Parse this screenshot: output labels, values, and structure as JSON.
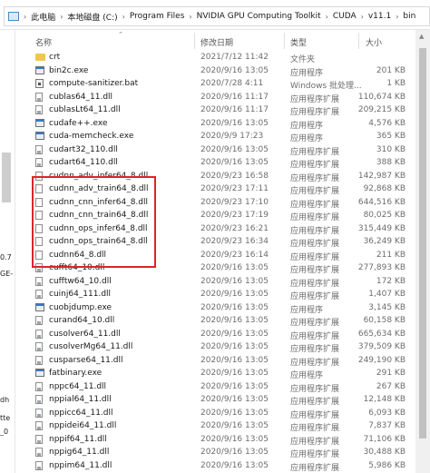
{
  "breadcrumb": {
    "items": [
      "此电脑",
      "本地磁盘 (C:)",
      "Program Files",
      "NVIDIA GPU Computing Toolkit",
      "CUDA",
      "v11.1",
      "bin"
    ]
  },
  "left_pane": {
    "fragments": [
      "0.7",
      "GE-",
      "dh",
      "tte",
      "_0"
    ]
  },
  "columns": {
    "name": "名称",
    "date": "修改日期",
    "type": "类型",
    "size": "大小"
  },
  "files": [
    {
      "icon": "folder",
      "name": "crt",
      "date": "2021/7/12 11:42",
      "type": "文件夹",
      "size": ""
    },
    {
      "icon": "exe",
      "name": "bin2c.exe",
      "date": "2020/9/16 13:05",
      "type": "应用程序",
      "size": "201 KB"
    },
    {
      "icon": "bat",
      "name": "compute-sanitizer.bat",
      "date": "2020/7/28 4:11",
      "type": "Windows 批处理...",
      "size": "1 KB"
    },
    {
      "icon": "dll",
      "name": "cublas64_11.dll",
      "date": "2020/9/16 11:17",
      "type": "应用程序扩展",
      "size": "110,674 KB"
    },
    {
      "icon": "dll",
      "name": "cublasLt64_11.dll",
      "date": "2020/9/16 11:17",
      "type": "应用程序扩展",
      "size": "209,215 KB"
    },
    {
      "icon": "exe",
      "name": "cudafe++.exe",
      "date": "2020/9/16 13:05",
      "type": "应用程序",
      "size": "4,576 KB"
    },
    {
      "icon": "exe",
      "name": "cuda-memcheck.exe",
      "date": "2020/9/9 17:23",
      "type": "应用程序",
      "size": "365 KB"
    },
    {
      "icon": "dll",
      "name": "cudart32_110.dll",
      "date": "2020/9/16 13:05",
      "type": "应用程序扩展",
      "size": "310 KB"
    },
    {
      "icon": "dll",
      "name": "cudart64_110.dll",
      "date": "2020/9/16 13:05",
      "type": "应用程序扩展",
      "size": "388 KB"
    },
    {
      "icon": "file",
      "name": "cudnn_adv_infer64_8.dll",
      "date": "2020/9/23 16:58",
      "type": "应用程序扩展",
      "size": "142,987 KB"
    },
    {
      "icon": "file",
      "name": "cudnn_adv_train64_8.dll",
      "date": "2020/9/23 17:11",
      "type": "应用程序扩展",
      "size": "92,868 KB"
    },
    {
      "icon": "file",
      "name": "cudnn_cnn_infer64_8.dll",
      "date": "2020/9/23 17:10",
      "type": "应用程序扩展",
      "size": "644,516 KB"
    },
    {
      "icon": "file",
      "name": "cudnn_cnn_train64_8.dll",
      "date": "2020/9/23 17:19",
      "type": "应用程序扩展",
      "size": "80,025 KB"
    },
    {
      "icon": "file",
      "name": "cudnn_ops_infer64_8.dll",
      "date": "2020/9/23 16:21",
      "type": "应用程序扩展",
      "size": "315,449 KB"
    },
    {
      "icon": "file",
      "name": "cudnn_ops_train64_8.dll",
      "date": "2020/9/23 16:34",
      "type": "应用程序扩展",
      "size": "36,249 KB"
    },
    {
      "icon": "file",
      "name": "cudnn64_8.dll",
      "date": "2020/9/23 16:14",
      "type": "应用程序扩展",
      "size": "211 KB"
    },
    {
      "icon": "dll",
      "name": "cufft64_10.dll",
      "date": "2020/9/16 13:05",
      "type": "应用程序扩展",
      "size": "277,893 KB"
    },
    {
      "icon": "dll",
      "name": "cufftw64_10.dll",
      "date": "2020/9/16 13:05",
      "type": "应用程序扩展",
      "size": "172 KB"
    },
    {
      "icon": "dll",
      "name": "cuinj64_111.dll",
      "date": "2020/9/16 13:05",
      "type": "应用程序扩展",
      "size": "1,407 KB"
    },
    {
      "icon": "exe",
      "name": "cuobjdump.exe",
      "date": "2020/9/16 13:05",
      "type": "应用程序",
      "size": "3,145 KB"
    },
    {
      "icon": "dll",
      "name": "curand64_10.dll",
      "date": "2020/9/16 13:05",
      "type": "应用程序扩展",
      "size": "60,158 KB"
    },
    {
      "icon": "dll",
      "name": "cusolver64_11.dll",
      "date": "2020/9/16 13:05",
      "type": "应用程序扩展",
      "size": "665,634 KB"
    },
    {
      "icon": "dll",
      "name": "cusolverMg64_11.dll",
      "date": "2020/9/16 13:05",
      "type": "应用程序扩展",
      "size": "379,509 KB"
    },
    {
      "icon": "dll",
      "name": "cusparse64_11.dll",
      "date": "2020/9/16 13:05",
      "type": "应用程序扩展",
      "size": "249,190 KB"
    },
    {
      "icon": "exe",
      "name": "fatbinary.exe",
      "date": "2020/9/16 13:05",
      "type": "应用程序",
      "size": "291 KB"
    },
    {
      "icon": "dll",
      "name": "nppc64_11.dll",
      "date": "2020/9/16 13:05",
      "type": "应用程序扩展",
      "size": "267 KB"
    },
    {
      "icon": "dll",
      "name": "nppial64_11.dll",
      "date": "2020/9/16 13:05",
      "type": "应用程序扩展",
      "size": "12,148 KB"
    },
    {
      "icon": "dll",
      "name": "nppicc64_11.dll",
      "date": "2020/9/16 13:05",
      "type": "应用程序扩展",
      "size": "6,093 KB"
    },
    {
      "icon": "dll",
      "name": "nppidei64_11.dll",
      "date": "2020/9/16 13:05",
      "type": "应用程序扩展",
      "size": "7,837 KB"
    },
    {
      "icon": "dll",
      "name": "nppif64_11.dll",
      "date": "2020/9/16 13:05",
      "type": "应用程序扩展",
      "size": "71,106 KB"
    },
    {
      "icon": "dll",
      "name": "nppig64_11.dll",
      "date": "2020/9/16 13:05",
      "type": "应用程序扩展",
      "size": "30,488 KB"
    },
    {
      "icon": "dll",
      "name": "nppim64_11.dll",
      "date": "2020/9/16 13:05",
      "type": "应用程序扩展",
      "size": "5,986 KB"
    }
  ],
  "highlight": {
    "color": "#d9262b"
  }
}
